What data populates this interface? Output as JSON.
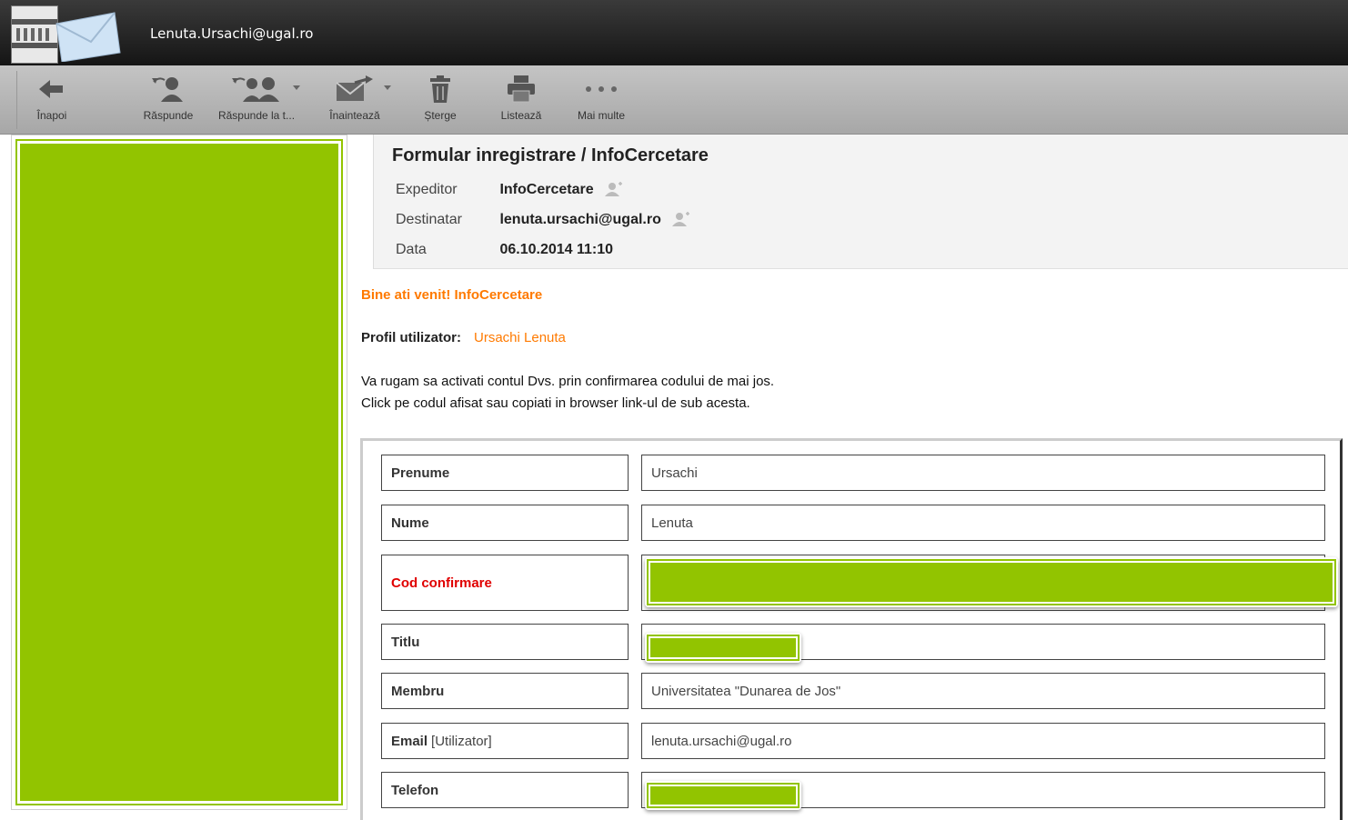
{
  "titlebar": {
    "user": "Lenuta.Ursachi@ugal.ro"
  },
  "toolbar": {
    "back": "Înapoi",
    "reply": "Răspunde",
    "reply_all": "Răspunde la t...",
    "forward": "Înaintează",
    "delete": "Șterge",
    "print": "Listează",
    "more": "Mai multe"
  },
  "message": {
    "subject": "Formular inregistrare / InfoCercetare",
    "from_label": "Expeditor",
    "from_value": "InfoCercetare",
    "to_label": "Destinatar",
    "to_value": "lenuta.ursachi@ugal.ro",
    "date_label": "Data",
    "date_value": "06.10.2014 11:10"
  },
  "body": {
    "welcome": "Bine ati venit! InfoCercetare",
    "profile_label": "Profil utilizator:",
    "profile_value": "Ursachi Lenuta",
    "instruction_1": "Va rugam sa activati contul Dvs. prin confirmarea codului de mai jos.",
    "instruction_2": "Click pe codul afisat sau copiati in browser link-ul de sub acesta."
  },
  "form": {
    "prenume_label": "Prenume",
    "prenume_value": "Ursachi",
    "nume_label": "Nume",
    "nume_value": "Lenuta",
    "cod_label": "Cod confirmare",
    "titlu_label": "Titlu",
    "membru_label": "Membru",
    "membru_value": "Universitatea \"Dunarea de Jos\"",
    "email_label": "Email",
    "email_note": "[Utilizator]",
    "email_value": "lenuta.ursachi@ugal.ro",
    "telefon_label": "Telefon"
  },
  "colors": {
    "redaction_green": "#92c400",
    "accent_orange": "#ff7a00",
    "alert_red": "#e00000"
  }
}
